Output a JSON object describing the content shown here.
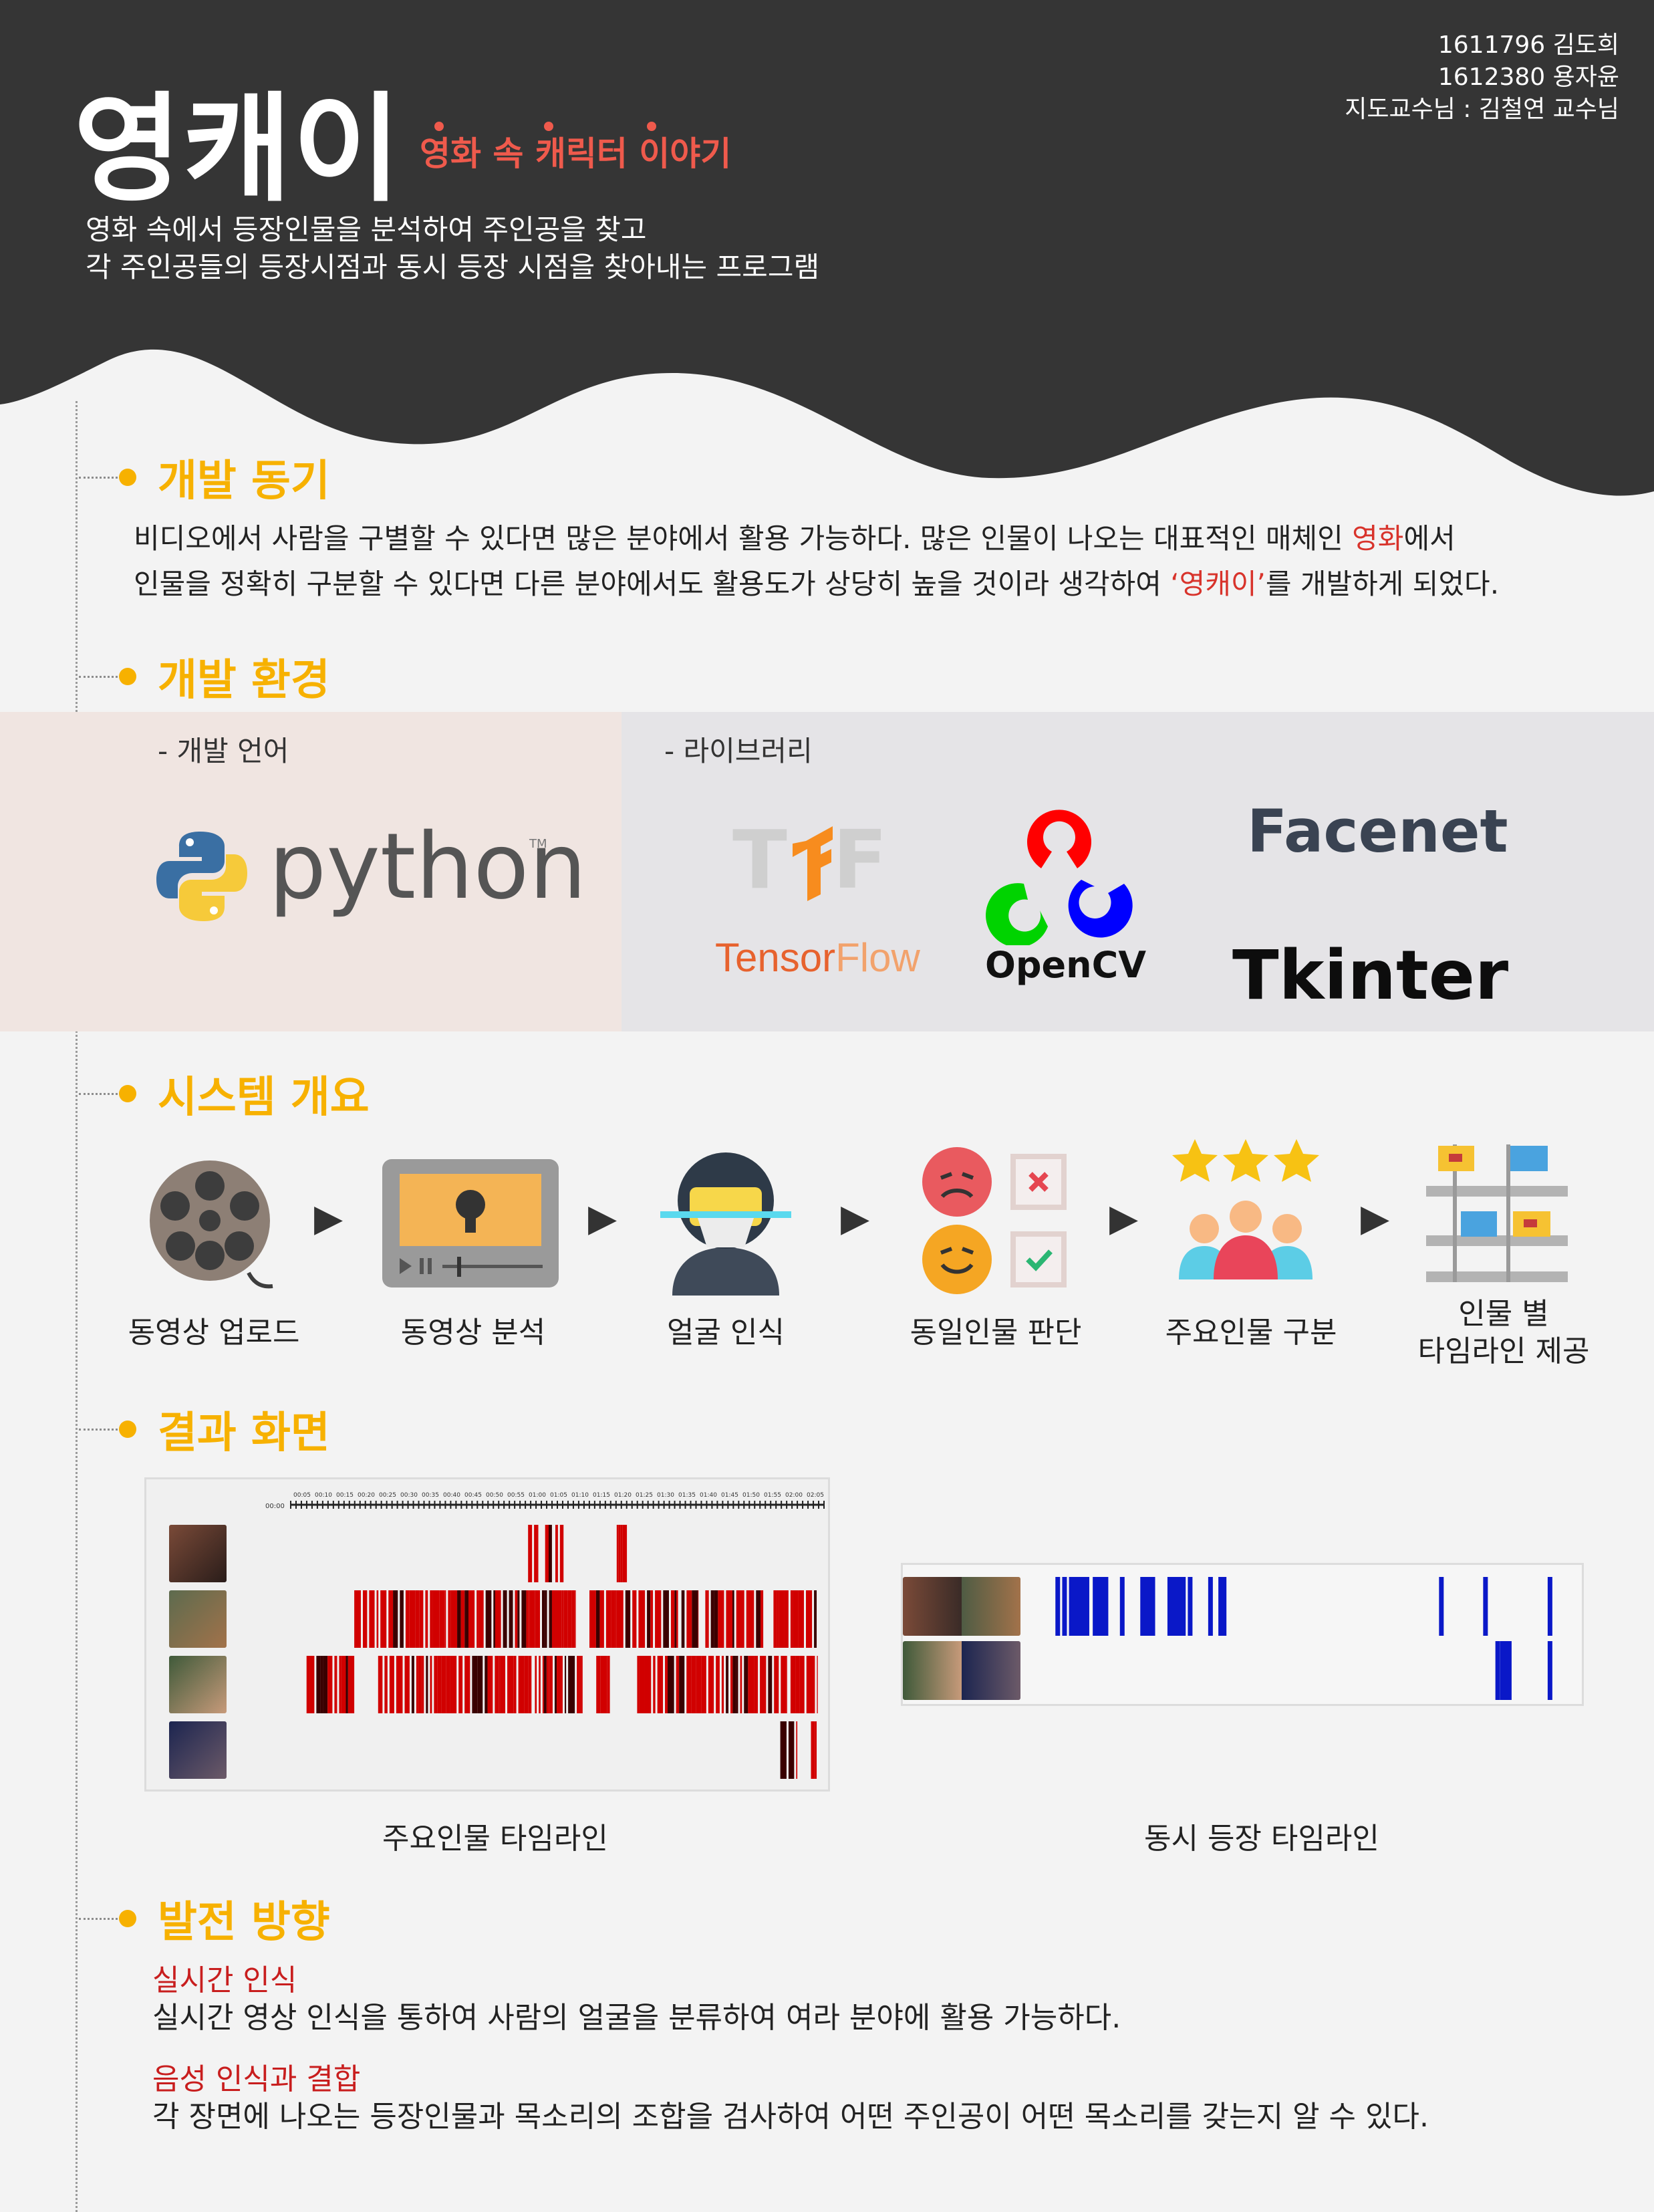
{
  "header": {
    "title": "영캐이",
    "subtitle": "영화 속 캐릭터 이야기",
    "credits": [
      "1611796 김도희",
      "1612380 용자윤",
      "지도교수님 : 김철연 교수님"
    ],
    "intro_lines": [
      "영화 속에서 등장인물을 분석하여 주인공을 찾고",
      "각 주인공들의 등장시점과 동시 등장 시점을 찾아내는 프로그램"
    ]
  },
  "sections": {
    "motivation": {
      "title": "개발 동기",
      "line1_a": "비디오에서 사람을 구별할 수 있다면 많은 분야에서 활용 가능하다. 많은 인물이 나오는 대표적인 매체인 ",
      "line1_red": "영화",
      "line1_b": "에서",
      "line2_a": "인물을 정확히 구분할 수 있다면 다른 분야에서도 활용도가 상당히 높을 것이라 생각하여 ",
      "line2_red": "‘영캐이’",
      "line2_b": "를 개발하게 되었다."
    },
    "environment": {
      "title": "개발 환경",
      "language_label": "- 개발 언어",
      "library_label": "- 라이브러리",
      "language_logo": "python",
      "trademark": "TM",
      "libraries": [
        "TensorFlow",
        "OpenCV",
        "Facenet",
        "Tkinter"
      ],
      "tf_tensor": "Tensor",
      "tf_flow": "Flow"
    },
    "system": {
      "title": "시스템 개요",
      "steps": [
        {
          "label": "동영상 업로드",
          "icon": "film-reel-icon"
        },
        {
          "label": "동영상 분석",
          "icon": "video-player-icon"
        },
        {
          "label": "얼굴 인식",
          "icon": "face-scan-icon"
        },
        {
          "label": "동일인물 판단",
          "icon": "face-compare-icon"
        },
        {
          "label": "주요인물 구분",
          "icon": "people-stars-icon"
        },
        {
          "label_line1": "인물 별",
          "label_line2": "타임라인 제공",
          "icon": "timeline-icon"
        }
      ]
    },
    "results": {
      "title": "결과 화면",
      "main_caption": "주요인물 타임라인",
      "co_caption": "동시 등장 타임라인",
      "axis_start": "00:00",
      "axis_ticks": [
        "00:05",
        "00:10",
        "00:15",
        "00:20",
        "00:25",
        "00:30",
        "00:35",
        "00:40",
        "00:45",
        "00:50",
        "00:55",
        "01:00",
        "01:05",
        "01:10",
        "01:15",
        "01:20",
        "01:25",
        "01:30",
        "01:35",
        "01:40",
        "01:45",
        "01:50",
        "01:55",
        "02:00",
        "02:05"
      ]
    },
    "future": {
      "title": "발전 방향",
      "items": [
        {
          "heading": "실시간 인식",
          "body": "실시간 영상 인식을 통하여 사람의 얼굴을 분류하여 여라 분야에 활용 가능하다."
        },
        {
          "heading": "음성 인식과 결합",
          "body": "각 장면에 나오는 등장인물과 목소리의 조합을 검사하여 어떤 주인공이 어떤 목소리를 갖는지 알 수 있다."
        }
      ]
    }
  },
  "colors": {
    "header_bg": "#353535",
    "accent_orange": "#f7b100",
    "subtitle_red": "#ef5a4c",
    "timeline_red": "#d10000",
    "timeline_blue": "#0a18c8"
  }
}
